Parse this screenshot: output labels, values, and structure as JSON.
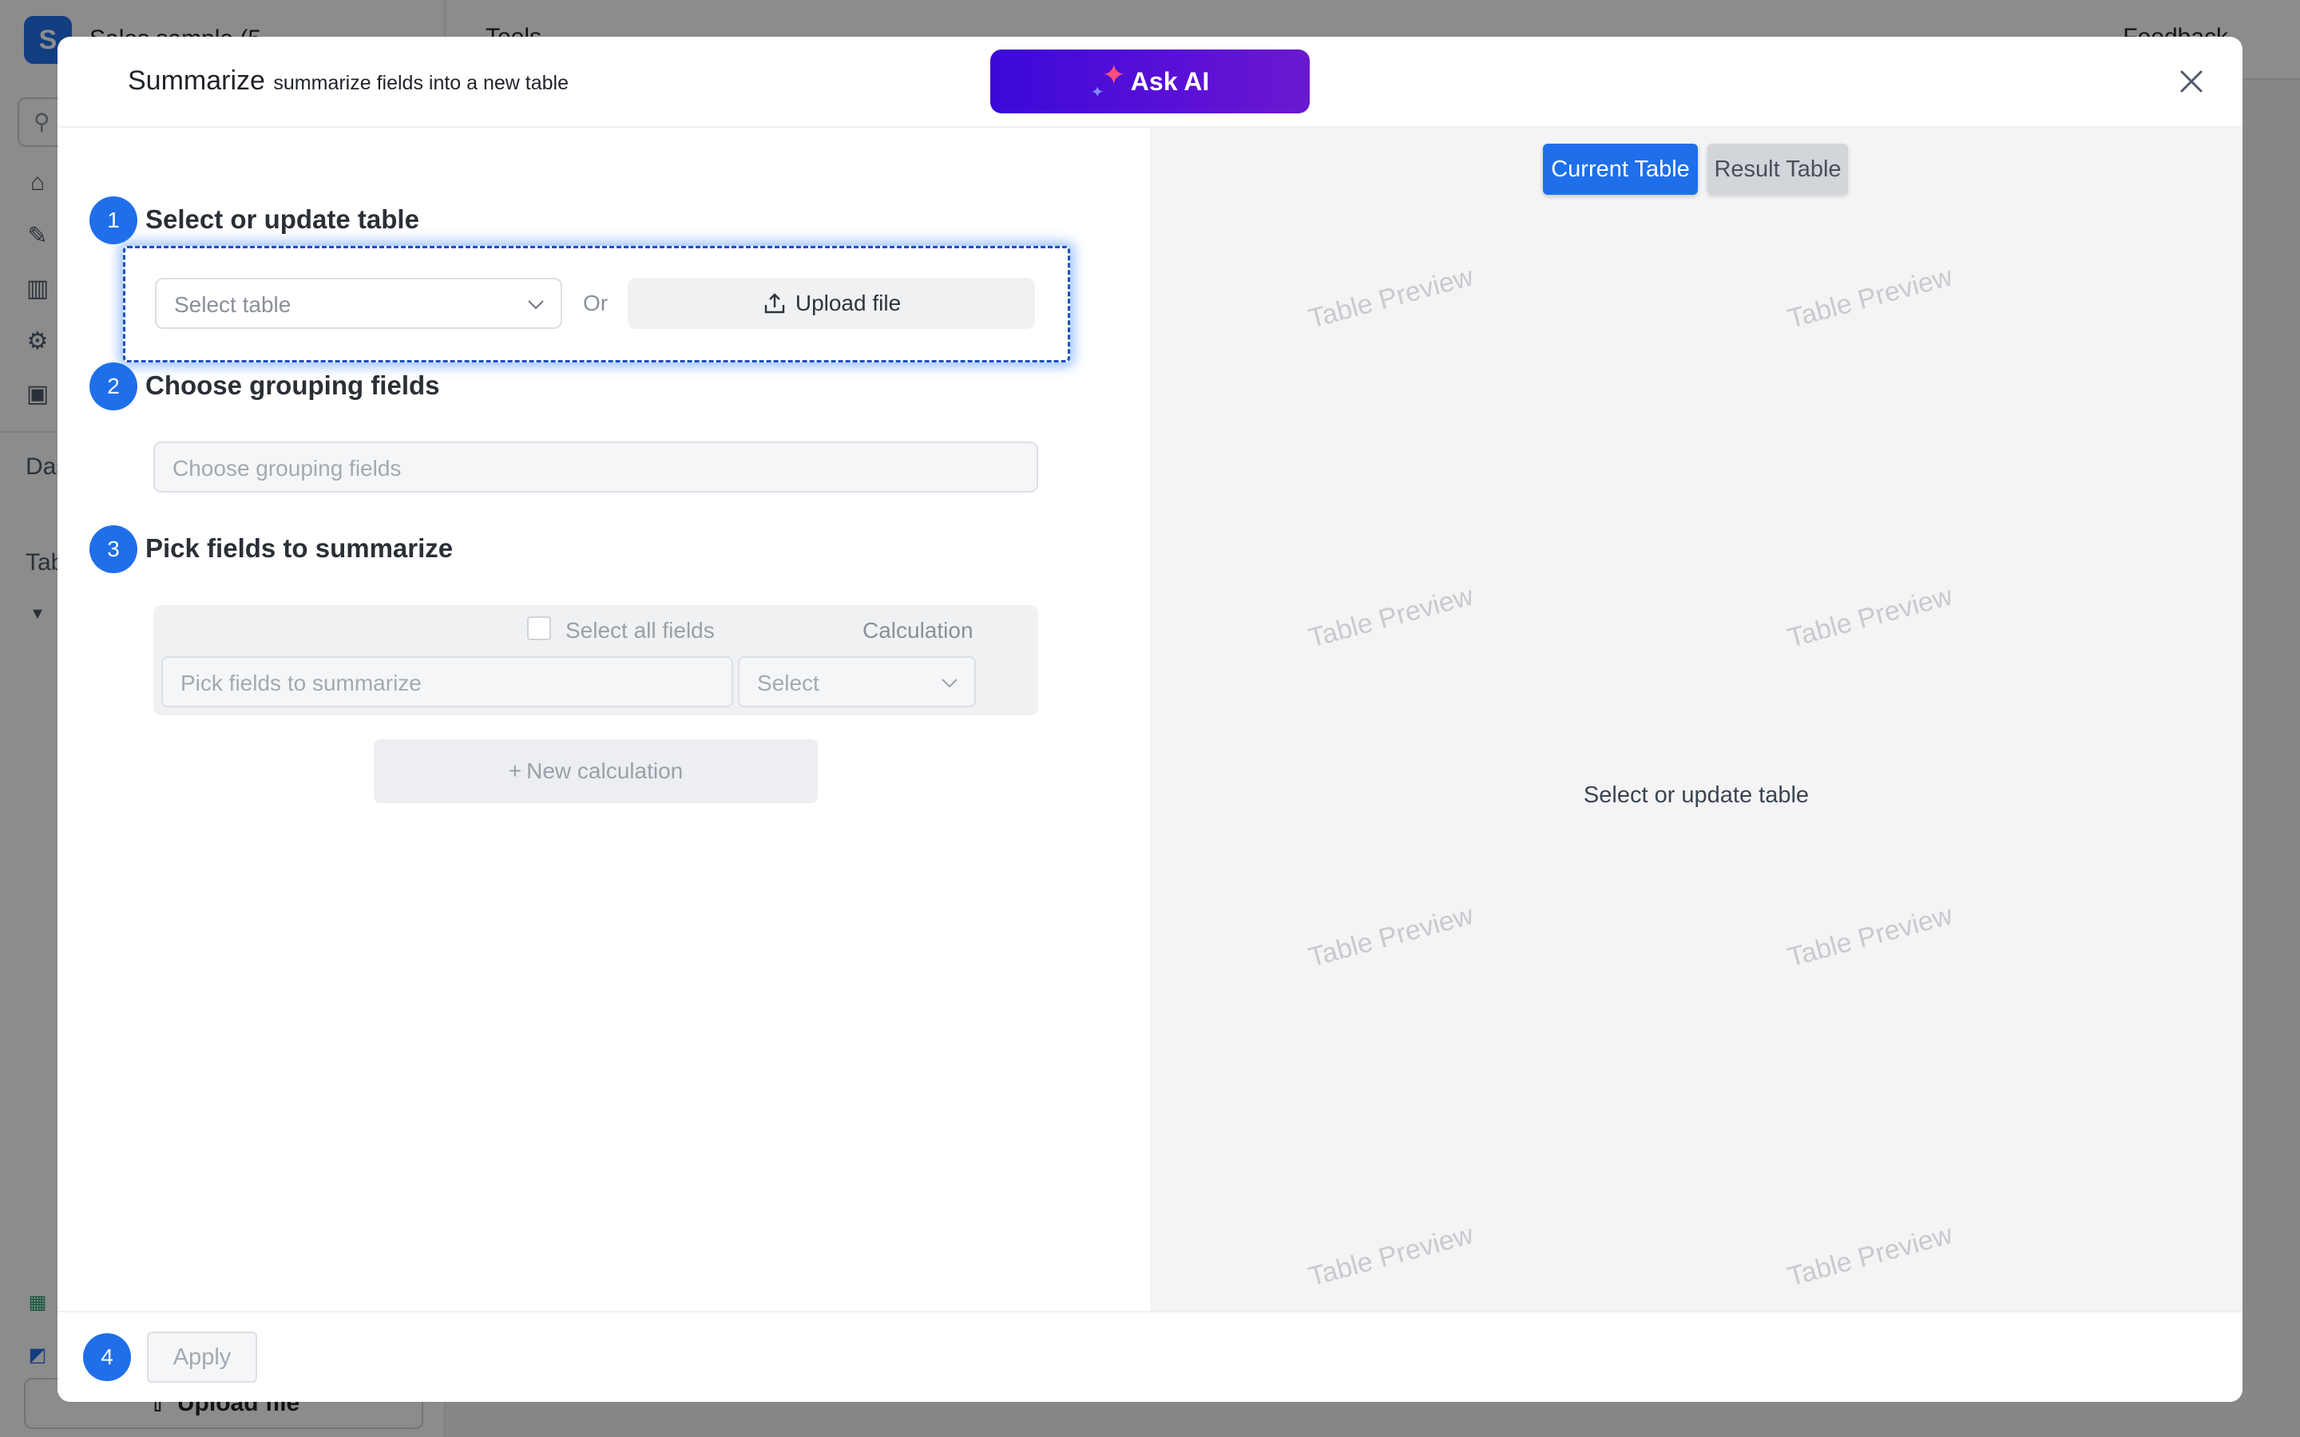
{
  "background": {
    "workspace_initial": "S",
    "workspace_name": "Sales sample (5",
    "topbar_tool": "Tools",
    "topbar_feedback": "Feedback",
    "sidebar_labels": [
      "Das",
      "Tab"
    ],
    "upload_label": "Upload file"
  },
  "modal": {
    "title": "Summarize",
    "subtitle": "summarize fields into a new table",
    "ask_ai_label": "Ask AI",
    "step1": {
      "number": "1",
      "title": "Select or update table",
      "select_placeholder": "Select table",
      "or_label": "Or",
      "upload_label": "Upload file"
    },
    "step2": {
      "number": "2",
      "title": "Choose grouping fields",
      "placeholder": "Choose grouping fields"
    },
    "step3": {
      "number": "3",
      "title": "Pick fields to summarize",
      "select_all_label": "Select all fields",
      "calculation_label": "Calculation",
      "fields_placeholder": "Pick fields to summarize",
      "calc_placeholder": "Select",
      "new_calc_label": "New calculation"
    },
    "step4": {
      "number": "4",
      "apply_label": "Apply"
    },
    "preview": {
      "tabs": [
        "Current Table",
        "Result Table"
      ],
      "watermark": "Table Preview",
      "message": "Select or update table"
    }
  },
  "colors": {
    "accent": "#1f6feb",
    "ask_ai_start": "#3b09d9",
    "ask_ai_end": "#6a19cf"
  }
}
